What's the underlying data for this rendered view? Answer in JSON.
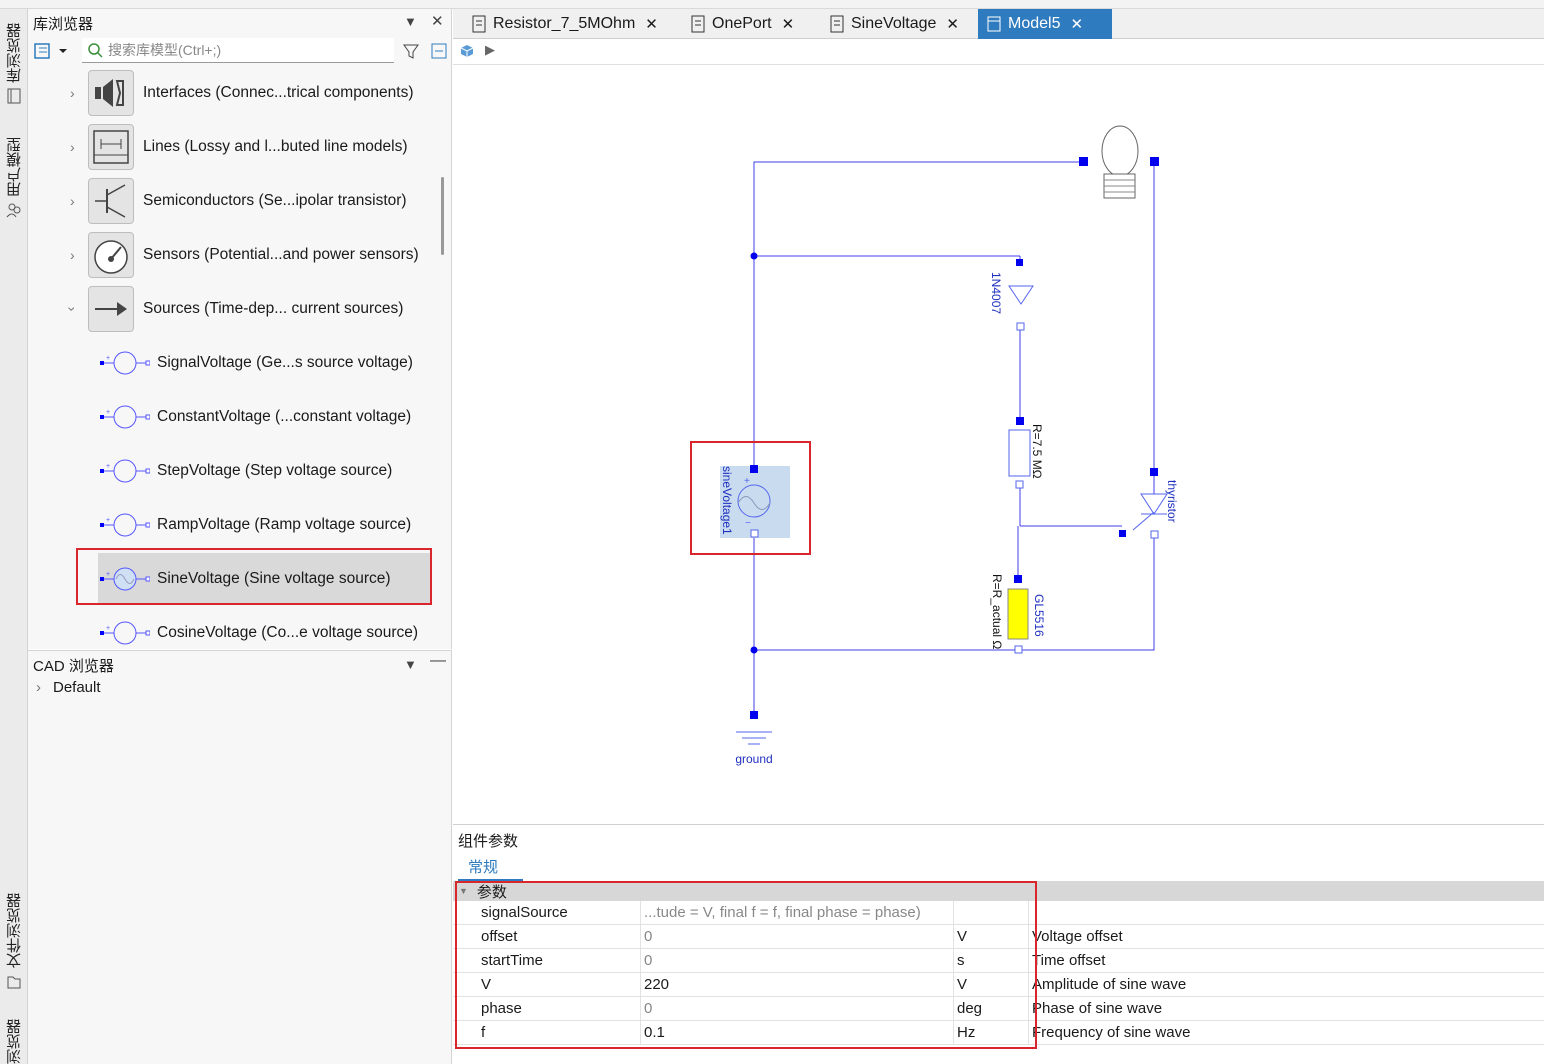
{
  "library": {
    "title": "库浏览器",
    "search_placeholder": "搜索库模型(Ctrl+;)",
    "items": [
      {
        "label": "Interfaces (Connec...trical components)",
        "expanded": false
      },
      {
        "label": "Lines (Lossy and l...buted line models)",
        "expanded": false
      },
      {
        "label": "Semiconductors (Se...ipolar transistor)",
        "expanded": false
      },
      {
        "label": "Sensors (Potential...and power sensors)",
        "expanded": false
      },
      {
        "label": "Sources (Time-dep... current sources)",
        "expanded": true
      }
    ],
    "children": [
      {
        "label": "SignalVoltage (Ge...s source voltage)"
      },
      {
        "label": "ConstantVoltage (...constant voltage)"
      },
      {
        "label": "StepVoltage (Step voltage source)"
      },
      {
        "label": "RampVoltage (Ramp voltage source)"
      },
      {
        "label": "SineVoltage (Sine voltage source)",
        "selected": true
      },
      {
        "label": "CosineVoltage (Co...e voltage source)"
      }
    ]
  },
  "cad": {
    "title": "CAD 浏览器",
    "items": [
      {
        "label": "Default"
      }
    ]
  },
  "side_tabs": {
    "library": "库浏览器",
    "user_models": "用户模型",
    "file_browser": "文件浏览器",
    "bottom": "浏览器"
  },
  "tabs": [
    {
      "label": "Resistor_7_5MOhm",
      "active": false
    },
    {
      "label": "OnePort",
      "active": false
    },
    {
      "label": "SineVoltage",
      "active": false
    },
    {
      "label": "Model5",
      "active": true
    }
  ],
  "diagram": {
    "diode_label": "1N4007",
    "resistor_label": "R=7.5 MΩ",
    "thyristor_label": "thyristor",
    "ldr_name": "GL5516",
    "ldr_value": "R=R_actual Ω",
    "source_label": "sineVoltage1",
    "ground_label": "ground"
  },
  "params": {
    "title": "组件参数",
    "tab": "常规",
    "group": "参数",
    "rows": [
      {
        "name": "signalSource",
        "value": "...tude = V,  final f = f,  final phase = phase)",
        "unit": "",
        "desc": ""
      },
      {
        "name": "offset",
        "value": "0",
        "unit": "V",
        "desc": "Voltage offset"
      },
      {
        "name": "startTime",
        "value": "0",
        "unit": "s",
        "desc": "Time offset"
      },
      {
        "name": "V",
        "value": "220",
        "unit": "V",
        "desc": "Amplitude of sine wave"
      },
      {
        "name": "phase",
        "value": "0",
        "unit": "deg",
        "desc": "Phase of sine wave"
      },
      {
        "name": "f",
        "value": "0.1",
        "unit": "Hz",
        "desc": "Frequency of sine wave"
      }
    ]
  },
  "colors": {
    "accent": "#2f7bbf",
    "wire": "#3f3ff0",
    "highlight_box": "#d9262c",
    "ldr_fill": "#ffff00"
  }
}
